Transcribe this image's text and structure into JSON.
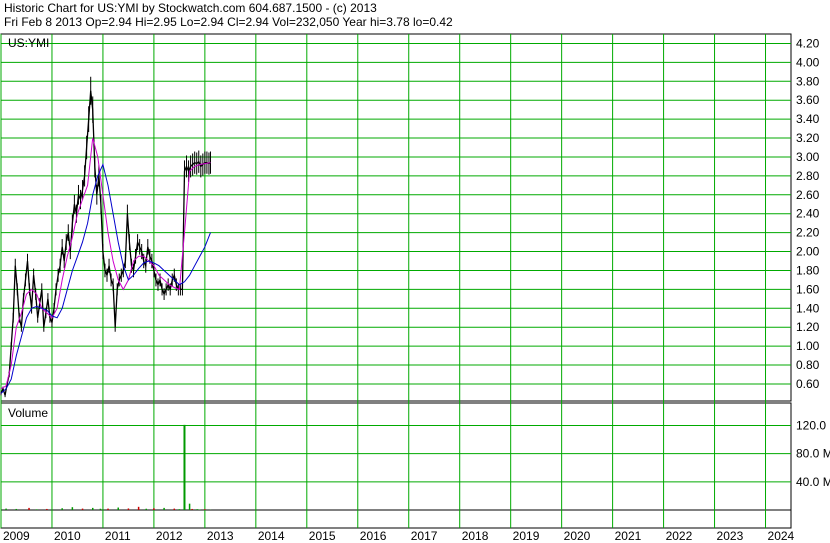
{
  "header": {
    "title": "Historic Chart for US:YMI by Stockwatch.com 604.687.1500 - (c) 2013",
    "quote": "Fri Feb  8 2013  Op=2.94  Hi=2.95  Lo=2.94  Cl=2.94  Vol=232,050  Year hi=3.78  lo=0.42"
  },
  "chart_data": [
    {
      "type": "line",
      "title": "US:YMI",
      "y_ticks": [
        "0.60",
        "0.80",
        "1.00",
        "1.20",
        "1.40",
        "1.60",
        "1.80",
        "2.00",
        "2.20",
        "2.40",
        "2.60",
        "2.80",
        "3.00",
        "3.20",
        "3.40",
        "3.60",
        "3.80",
        "4.00",
        "4.20"
      ],
      "ylim": [
        0.42,
        4.3
      ],
      "grid": true,
      "x_ticks": [
        "2009",
        "2010",
        "2011",
        "2012",
        "2013",
        "2014",
        "2015",
        "2016",
        "2017",
        "2018",
        "2019",
        "2020",
        "2021",
        "2022",
        "2023",
        "2024"
      ],
      "colors": {
        "price": "#000000",
        "ma_short": "#cc00cc",
        "ma_long": "#0000cc",
        "grid": "#00aa00"
      },
      "series": [
        {
          "x": [
            2009.0,
            2009.04,
            2009.08,
            2009.12,
            2009.16,
            2009.2,
            2009.24,
            2009.28,
            2009.32,
            2009.36,
            2009.4,
            2009.44,
            2009.48,
            2009.52,
            2009.56,
            2009.6,
            2009.64,
            2009.68,
            2009.72,
            2009.76,
            2009.8,
            2009.84,
            2009.88,
            2009.92,
            2009.96,
            2010.0,
            2010.04,
            2010.08,
            2010.12,
            2010.16,
            2010.2,
            2010.24,
            2010.28,
            2010.32,
            2010.36,
            2010.4,
            2010.44,
            2010.48,
            2010.52,
            2010.56,
            2010.6,
            2010.64,
            2010.68,
            2010.72,
            2010.76,
            2010.8,
            2010.84,
            2010.88,
            2010.92,
            2010.96,
            2011.0,
            2011.04,
            2011.08,
            2011.12,
            2011.16,
            2011.2,
            2011.24,
            2011.28,
            2011.32,
            2011.36,
            2011.4,
            2011.44,
            2011.48,
            2011.52,
            2011.56,
            2011.6,
            2011.64,
            2011.68,
            2011.72,
            2011.76,
            2011.8,
            2011.84,
            2011.88,
            2011.92,
            2011.96,
            2012.0,
            2012.04,
            2012.08,
            2012.12,
            2012.16,
            2012.2,
            2012.24,
            2012.28,
            2012.32,
            2012.36,
            2012.4,
            2012.44,
            2012.48,
            2012.52,
            2012.56,
            2012.6,
            2012.64,
            2012.68,
            2012.72,
            2012.76,
            2012.8,
            2012.84,
            2012.88,
            2012.92,
            2012.96,
            2013.0,
            2013.04,
            2013.08,
            2013.11
          ],
          "values": [
            0.5,
            0.55,
            0.48,
            0.6,
            0.7,
            1.0,
            1.3,
            1.85,
            1.6,
            1.3,
            1.2,
            1.5,
            1.7,
            1.9,
            1.6,
            1.4,
            1.75,
            1.55,
            1.3,
            1.45,
            1.6,
            1.2,
            1.35,
            1.5,
            1.3,
            1.25,
            1.4,
            1.6,
            1.75,
            1.85,
            2.05,
            1.9,
            2.1,
            2.2,
            2.0,
            2.3,
            2.5,
            2.4,
            2.6,
            2.55,
            2.65,
            2.8,
            3.1,
            3.4,
            3.7,
            3.5,
            2.9,
            2.6,
            2.8,
            2.5,
            2.0,
            1.8,
            1.75,
            1.85,
            1.7,
            1.65,
            1.2,
            1.6,
            1.7,
            1.75,
            1.8,
            1.9,
            2.4,
            2.1,
            1.85,
            1.8,
            1.95,
            2.1,
            2.05,
            2.0,
            1.9,
            1.85,
            2.05,
            1.95,
            1.9,
            1.8,
            1.7,
            1.65,
            1.7,
            1.6,
            1.55,
            1.6,
            1.65,
            1.6,
            1.7,
            1.75,
            1.65,
            1.6,
            1.6,
            1.6,
            2.85,
            2.9,
            2.85,
            2.9,
            2.92,
            2.94,
            2.93,
            2.95,
            2.9,
            2.92,
            2.94,
            2.94,
            2.93,
            2.94
          ]
        },
        {
          "x": [
            2009.0,
            2009.1,
            2009.2,
            2009.3,
            2009.4,
            2009.5,
            2009.6,
            2009.7,
            2009.8,
            2009.9,
            2010.0,
            2010.1,
            2010.2,
            2010.3,
            2010.4,
            2010.5,
            2010.6,
            2010.7,
            2010.8,
            2010.9,
            2011.0,
            2011.1,
            2011.2,
            2011.3,
            2011.4,
            2011.5,
            2011.6,
            2011.7,
            2011.8,
            2011.9,
            2012.0,
            2012.1,
            2012.2,
            2012.3,
            2012.4,
            2012.5,
            2012.6,
            2012.7,
            2012.8,
            2012.9,
            2013.0,
            2013.11
          ],
          "values": [
            0.55,
            0.58,
            0.8,
            1.2,
            1.35,
            1.55,
            1.6,
            1.55,
            1.4,
            1.35,
            1.3,
            1.4,
            1.7,
            1.95,
            2.15,
            2.4,
            2.55,
            2.7,
            3.2,
            3.0,
            2.6,
            2.2,
            1.9,
            1.7,
            1.6,
            1.7,
            1.9,
            1.95,
            1.95,
            1.9,
            1.85,
            1.75,
            1.7,
            1.65,
            1.62,
            1.6,
            2.2,
            2.85,
            2.9,
            2.92,
            2.93,
            2.94
          ]
        },
        {
          "x": [
            2009.0,
            2009.1,
            2009.2,
            2009.3,
            2009.4,
            2009.5,
            2009.6,
            2009.7,
            2009.8,
            2009.9,
            2010.0,
            2010.1,
            2010.2,
            2010.3,
            2010.4,
            2010.5,
            2010.6,
            2010.7,
            2010.8,
            2010.9,
            2011.0,
            2011.1,
            2011.2,
            2011.3,
            2011.4,
            2011.5,
            2011.6,
            2011.7,
            2011.8,
            2011.9,
            2012.0,
            2012.1,
            2012.2,
            2012.3,
            2012.4,
            2012.5,
            2012.6,
            2012.7,
            2012.8,
            2012.9,
            2013.0,
            2013.11
          ],
          "values": [
            0.5,
            0.55,
            0.65,
            0.9,
            1.1,
            1.3,
            1.4,
            1.42,
            1.4,
            1.38,
            1.32,
            1.3,
            1.4,
            1.6,
            1.8,
            1.95,
            2.1,
            2.3,
            2.6,
            2.8,
            2.92,
            2.7,
            2.4,
            2.1,
            1.85,
            1.7,
            1.75,
            1.82,
            1.88,
            1.9,
            1.88,
            1.85,
            1.8,
            1.75,
            1.7,
            1.65,
            1.68,
            1.75,
            1.85,
            1.95,
            2.05,
            2.2
          ]
        }
      ]
    },
    {
      "type": "bar",
      "title": "Volume",
      "y_ticks": [
        "40.0 M",
        "80.0 M",
        "120.0 M"
      ],
      "ylim": [
        0,
        152
      ],
      "colors": {
        "up": "#009900",
        "down": "#cc0000",
        "spike": "#009900"
      },
      "x": [
        2009.1,
        2009.3,
        2009.55,
        2009.7,
        2009.9,
        2010.2,
        2010.4,
        2010.6,
        2010.8,
        2010.95,
        2011.1,
        2011.3,
        2011.5,
        2011.7,
        2011.85,
        2012.0,
        2012.2,
        2012.4,
        2012.5,
        2012.6,
        2012.7,
        2012.75,
        2012.85,
        2012.9,
        2013.0,
        2013.11
      ],
      "values": [
        2,
        1.5,
        3,
        1,
        1.5,
        2.5,
        4,
        2,
        3,
        1.8,
        2,
        3.5,
        2.2,
        4.5,
        1.8,
        2.5,
        3,
        2,
        1.2,
        121,
        9,
        1.5,
        1.2,
        0.8,
        1.1,
        0.23
      ],
      "direction": [
        "up",
        "up",
        "down",
        "up",
        "down",
        "up",
        "up",
        "down",
        "up",
        "up",
        "down",
        "up",
        "down",
        "down",
        "up",
        "down",
        "up",
        "down",
        "up",
        "spike",
        "up",
        "down",
        "up",
        "up",
        "down",
        "up"
      ]
    }
  ]
}
